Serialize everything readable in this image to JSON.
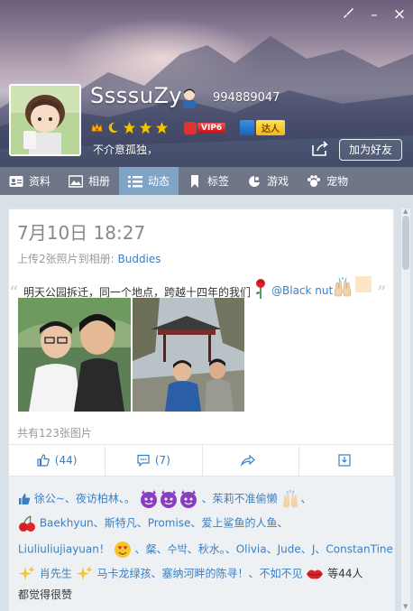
{
  "window": {
    "skin_icon": "paintbrush-icon",
    "minimize_label": "–",
    "close_label": "×"
  },
  "profile": {
    "nickname": "SsssuZy",
    "qq_number": "994889047",
    "vip_label": "VIP6",
    "daren_label": "达人",
    "signature": "不介意孤独，",
    "add_friend_label": "加为好友"
  },
  "nav": {
    "tabs": [
      {
        "label": "资料",
        "icon": "profile-card-icon"
      },
      {
        "label": "相册",
        "icon": "photo-album-icon"
      },
      {
        "label": "动态",
        "icon": "list-icon"
      },
      {
        "label": "标签",
        "icon": "bookmark-icon"
      },
      {
        "label": "游戏",
        "icon": "game-icon"
      },
      {
        "label": "宠物",
        "icon": "pet-paw-icon"
      }
    ],
    "active_index": 2
  },
  "post": {
    "date": "7月10日 18:27",
    "upload_prefix": "上传2张照片到相册:",
    "album_name": "Buddies",
    "text": "明天公园拆迁，同一个地点，跨越十四年的我们",
    "mention": "@Black nut",
    "photo_count_text": "共有123张图片",
    "actions": {
      "like_count": "(44)",
      "comment_count": "(7)"
    }
  },
  "likes": {
    "line1": {
      "a": "徐公~",
      "b": "夜访柏林",
      "c": "。",
      "d": "茱莉不准偷懒"
    },
    "line2": {
      "a": "Baekhyun",
      "b": "斯特凡",
      "c": "Promise",
      "d": "爱上鲨鱼的人鱼"
    },
    "line3": {
      "a": "Liuliuliujiayuan！",
      "b": "粲",
      "c": "수박",
      "d": "秋水。",
      "e": "Olivia",
      "f": "Jude",
      "g": "J",
      "h": "ConstanTine"
    },
    "line4": {
      "a": "肖先生",
      "b": "马卡龙绿孩",
      "c": "塞纳河畔的陈寻！",
      "d": "不如不见",
      "e": "等44人"
    },
    "line5": "都觉得很赞"
  },
  "colors": {
    "nav_bg": "#6f7688",
    "nav_active": "#7fa4c6",
    "link_blue": "#3a7fc5"
  }
}
